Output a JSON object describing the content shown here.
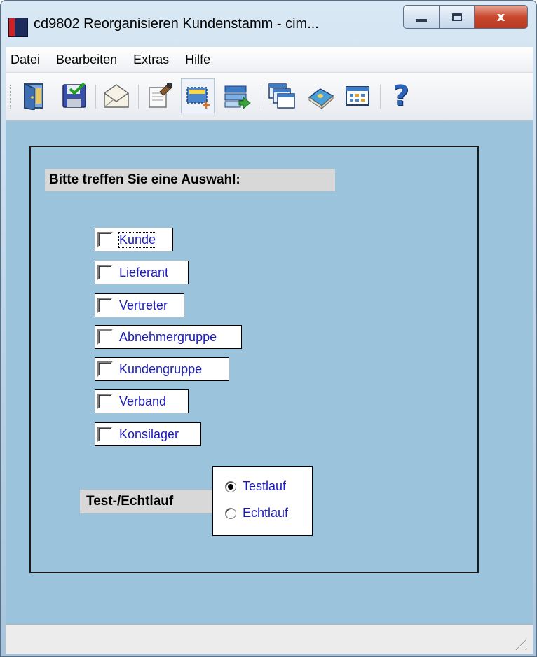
{
  "window": {
    "title": "cd9802 Reorganisieren Kundenstamm - cim...",
    "close_glyph": "x"
  },
  "menu": {
    "items": [
      {
        "label": "Datei"
      },
      {
        "label": "Bearbeiten"
      },
      {
        "label": "Extras"
      },
      {
        "label": "Hilfe"
      }
    ]
  },
  "toolbar": {
    "icons": [
      "exit-door-icon",
      "save-icon",
      "mail-envelope-icon",
      "edit-notepad-icon",
      "new-selection-icon",
      "list-import-icon",
      "windows-cascade-icon",
      "book-icon",
      "table-grid-icon",
      "help-icon"
    ],
    "help_glyph": "?"
  },
  "form": {
    "heading": "Bitte treffen Sie eine Auswahl:",
    "checkboxes": [
      {
        "label": "Kunde",
        "checked": false
      },
      {
        "label": "Lieferant",
        "checked": false
      },
      {
        "label": "Vertreter",
        "checked": false
      },
      {
        "label": "Abnehmergruppe",
        "checked": false
      },
      {
        "label": "Kundengruppe",
        "checked": false
      },
      {
        "label": "Verband",
        "checked": false
      },
      {
        "label": "Konsilager",
        "checked": false
      }
    ],
    "mode_label": "Test-/Echtlauf",
    "radios": [
      {
        "label": "Testlauf",
        "checked": true
      },
      {
        "label": "Echtlauf",
        "checked": false
      }
    ]
  },
  "colors": {
    "client_background": "#9cc3dc",
    "control_text": "#1b1bbb",
    "label_background": "#d8d8d8",
    "close_button": "#c8482f"
  }
}
